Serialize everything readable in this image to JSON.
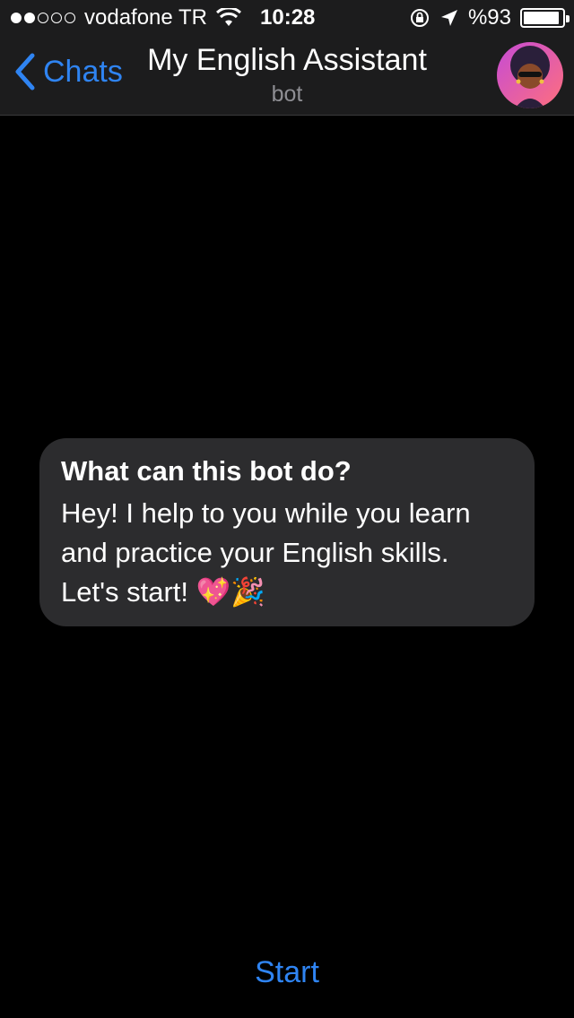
{
  "status_bar": {
    "carrier": "vodafone TR",
    "time": "10:28",
    "battery_label": "%93",
    "battery_level": 0.93,
    "signal_strength": 2,
    "signal_max": 5
  },
  "nav": {
    "back_label": "Chats",
    "title": "My English Assistant",
    "subtitle": "bot",
    "accent_color": "#2f84f2"
  },
  "info": {
    "heading": "What can this bot do?",
    "lines": [
      "Hey! I help to you while you learn",
      "and practice your English skills.",
      "Let's start! 💖🎉"
    ]
  },
  "footer": {
    "start_label": "Start"
  }
}
